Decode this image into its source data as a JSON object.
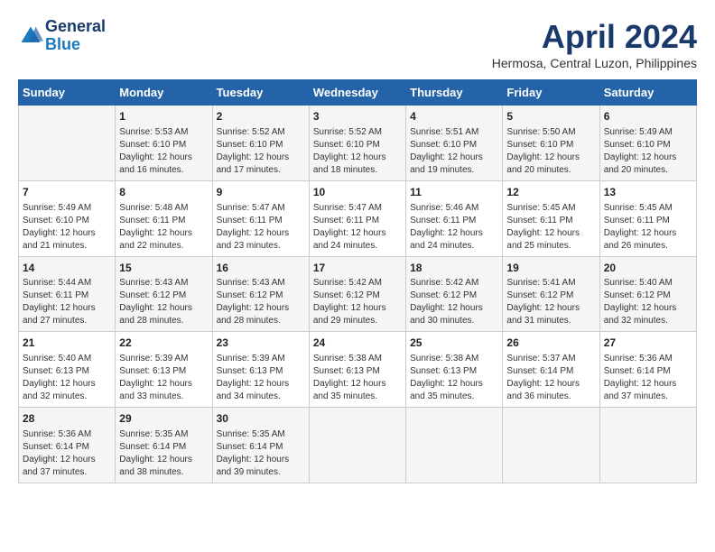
{
  "header": {
    "logo_general": "General",
    "logo_blue": "Blue",
    "month_title": "April 2024",
    "location": "Hermosa, Central Luzon, Philippines"
  },
  "days_of_week": [
    "Sunday",
    "Monday",
    "Tuesday",
    "Wednesday",
    "Thursday",
    "Friday",
    "Saturday"
  ],
  "weeks": [
    [
      {
        "day": "",
        "info": ""
      },
      {
        "day": "1",
        "info": "Sunrise: 5:53 AM\nSunset: 6:10 PM\nDaylight: 12 hours and 16 minutes."
      },
      {
        "day": "2",
        "info": "Sunrise: 5:52 AM\nSunset: 6:10 PM\nDaylight: 12 hours and 17 minutes."
      },
      {
        "day": "3",
        "info": "Sunrise: 5:52 AM\nSunset: 6:10 PM\nDaylight: 12 hours and 18 minutes."
      },
      {
        "day": "4",
        "info": "Sunrise: 5:51 AM\nSunset: 6:10 PM\nDaylight: 12 hours and 19 minutes."
      },
      {
        "day": "5",
        "info": "Sunrise: 5:50 AM\nSunset: 6:10 PM\nDaylight: 12 hours and 20 minutes."
      },
      {
        "day": "6",
        "info": "Sunrise: 5:49 AM\nSunset: 6:10 PM\nDaylight: 12 hours and 20 minutes."
      }
    ],
    [
      {
        "day": "7",
        "info": "Sunrise: 5:49 AM\nSunset: 6:10 PM\nDaylight: 12 hours and 21 minutes."
      },
      {
        "day": "8",
        "info": "Sunrise: 5:48 AM\nSunset: 6:11 PM\nDaylight: 12 hours and 22 minutes."
      },
      {
        "day": "9",
        "info": "Sunrise: 5:47 AM\nSunset: 6:11 PM\nDaylight: 12 hours and 23 minutes."
      },
      {
        "day": "10",
        "info": "Sunrise: 5:47 AM\nSunset: 6:11 PM\nDaylight: 12 hours and 24 minutes."
      },
      {
        "day": "11",
        "info": "Sunrise: 5:46 AM\nSunset: 6:11 PM\nDaylight: 12 hours and 24 minutes."
      },
      {
        "day": "12",
        "info": "Sunrise: 5:45 AM\nSunset: 6:11 PM\nDaylight: 12 hours and 25 minutes."
      },
      {
        "day": "13",
        "info": "Sunrise: 5:45 AM\nSunset: 6:11 PM\nDaylight: 12 hours and 26 minutes."
      }
    ],
    [
      {
        "day": "14",
        "info": "Sunrise: 5:44 AM\nSunset: 6:11 PM\nDaylight: 12 hours and 27 minutes."
      },
      {
        "day": "15",
        "info": "Sunrise: 5:43 AM\nSunset: 6:12 PM\nDaylight: 12 hours and 28 minutes."
      },
      {
        "day": "16",
        "info": "Sunrise: 5:43 AM\nSunset: 6:12 PM\nDaylight: 12 hours and 28 minutes."
      },
      {
        "day": "17",
        "info": "Sunrise: 5:42 AM\nSunset: 6:12 PM\nDaylight: 12 hours and 29 minutes."
      },
      {
        "day": "18",
        "info": "Sunrise: 5:42 AM\nSunset: 6:12 PM\nDaylight: 12 hours and 30 minutes."
      },
      {
        "day": "19",
        "info": "Sunrise: 5:41 AM\nSunset: 6:12 PM\nDaylight: 12 hours and 31 minutes."
      },
      {
        "day": "20",
        "info": "Sunrise: 5:40 AM\nSunset: 6:12 PM\nDaylight: 12 hours and 32 minutes."
      }
    ],
    [
      {
        "day": "21",
        "info": "Sunrise: 5:40 AM\nSunset: 6:13 PM\nDaylight: 12 hours and 32 minutes."
      },
      {
        "day": "22",
        "info": "Sunrise: 5:39 AM\nSunset: 6:13 PM\nDaylight: 12 hours and 33 minutes."
      },
      {
        "day": "23",
        "info": "Sunrise: 5:39 AM\nSunset: 6:13 PM\nDaylight: 12 hours and 34 minutes."
      },
      {
        "day": "24",
        "info": "Sunrise: 5:38 AM\nSunset: 6:13 PM\nDaylight: 12 hours and 35 minutes."
      },
      {
        "day": "25",
        "info": "Sunrise: 5:38 AM\nSunset: 6:13 PM\nDaylight: 12 hours and 35 minutes."
      },
      {
        "day": "26",
        "info": "Sunrise: 5:37 AM\nSunset: 6:14 PM\nDaylight: 12 hours and 36 minutes."
      },
      {
        "day": "27",
        "info": "Sunrise: 5:36 AM\nSunset: 6:14 PM\nDaylight: 12 hours and 37 minutes."
      }
    ],
    [
      {
        "day": "28",
        "info": "Sunrise: 5:36 AM\nSunset: 6:14 PM\nDaylight: 12 hours and 37 minutes."
      },
      {
        "day": "29",
        "info": "Sunrise: 5:35 AM\nSunset: 6:14 PM\nDaylight: 12 hours and 38 minutes."
      },
      {
        "day": "30",
        "info": "Sunrise: 5:35 AM\nSunset: 6:14 PM\nDaylight: 12 hours and 39 minutes."
      },
      {
        "day": "",
        "info": ""
      },
      {
        "day": "",
        "info": ""
      },
      {
        "day": "",
        "info": ""
      },
      {
        "day": "",
        "info": ""
      }
    ]
  ]
}
